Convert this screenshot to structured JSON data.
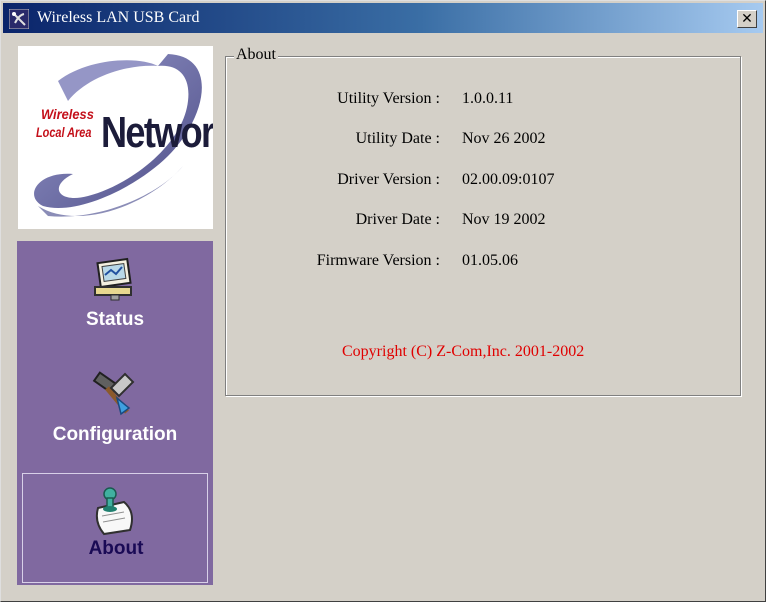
{
  "window": {
    "title": "Wireless LAN USB Card",
    "close_glyph": "✕"
  },
  "logo": {
    "line1": "Wireless",
    "line2": "Local Area",
    "big": "Network"
  },
  "nav": {
    "items": [
      {
        "label": "Status",
        "icon": "status-monitor-icon",
        "active": false
      },
      {
        "label": "Configuration",
        "icon": "configuration-tools-icon",
        "active": false
      },
      {
        "label": "About",
        "icon": "about-scroll-icon",
        "active": true
      }
    ]
  },
  "about": {
    "legend": "About",
    "rows": [
      {
        "label": "Utility Version :",
        "value": "1.0.0.11"
      },
      {
        "label": "Utility Date :",
        "value": "Nov 26 2002"
      },
      {
        "label": "Driver Version :",
        "value": "02.00.09:0107"
      },
      {
        "label": "Driver Date :",
        "value": "Nov 19 2002"
      },
      {
        "label": "Firmware Version :",
        "value": "01.05.06"
      }
    ],
    "copyright": "Copyright (C) Z-Com,Inc. 2001-2002"
  },
  "colors": {
    "nav_bg": "#8069a0",
    "copyright": "#e00000",
    "titlebar": "#0a246a"
  }
}
